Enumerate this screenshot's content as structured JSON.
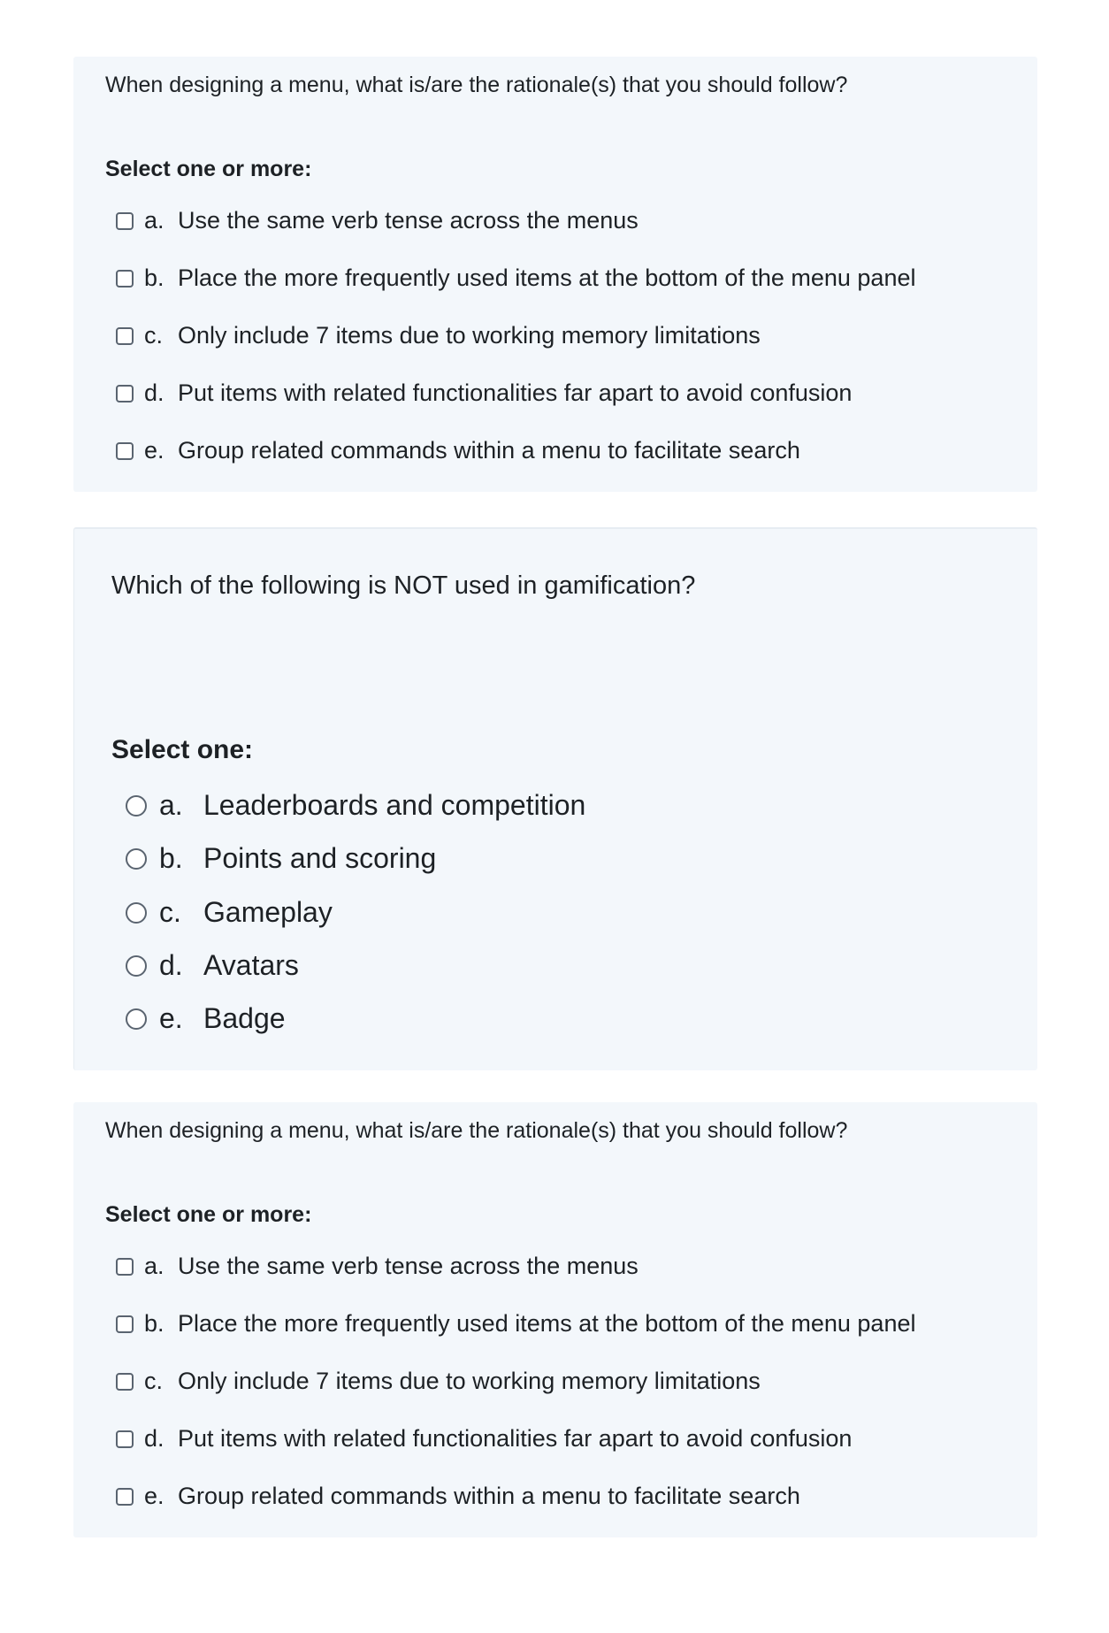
{
  "questions": [
    {
      "question": "When designing a menu, what is/are the rationale(s) that you should follow?",
      "prompt": "Select one or more:",
      "answers": [
        {
          "letter": "a.",
          "text": "Use the same verb tense across the menus"
        },
        {
          "letter": "b.",
          "text": "Place the more frequently used items at the bottom of the menu panel"
        },
        {
          "letter": "c.",
          "text": "Only include 7 items due to working memory limitations"
        },
        {
          "letter": "d.",
          "text": "Put items with related functionalities far apart to avoid confusion"
        },
        {
          "letter": "e.",
          "text": "Group related commands within a menu to facilitate search"
        }
      ]
    },
    {
      "question": "Which of the following is NOT used in gamification?",
      "prompt": "Select one:",
      "answers": [
        {
          "letter": "a.",
          "text": "Leaderboards and competition"
        },
        {
          "letter": "b.",
          "text": "Points and scoring"
        },
        {
          "letter": "c.",
          "text": "Gameplay"
        },
        {
          "letter": "d.",
          "text": "Avatars"
        },
        {
          "letter": "e.",
          "text": "Badge"
        }
      ]
    },
    {
      "question": "When designing a menu, what is/are the rationale(s) that you should follow?",
      "prompt": "Select one or more:",
      "answers": [
        {
          "letter": "a.",
          "text": "Use the same verb tense across the menus"
        },
        {
          "letter": "b.",
          "text": "Place the more frequently used items at the bottom of the menu panel"
        },
        {
          "letter": "c.",
          "text": "Only include 7 items due to working memory limitations"
        },
        {
          "letter": "d.",
          "text": "Put items with related functionalities far apart to avoid confusion"
        },
        {
          "letter": "e.",
          "text": "Group related commands within a menu to facilitate search"
        }
      ]
    }
  ]
}
